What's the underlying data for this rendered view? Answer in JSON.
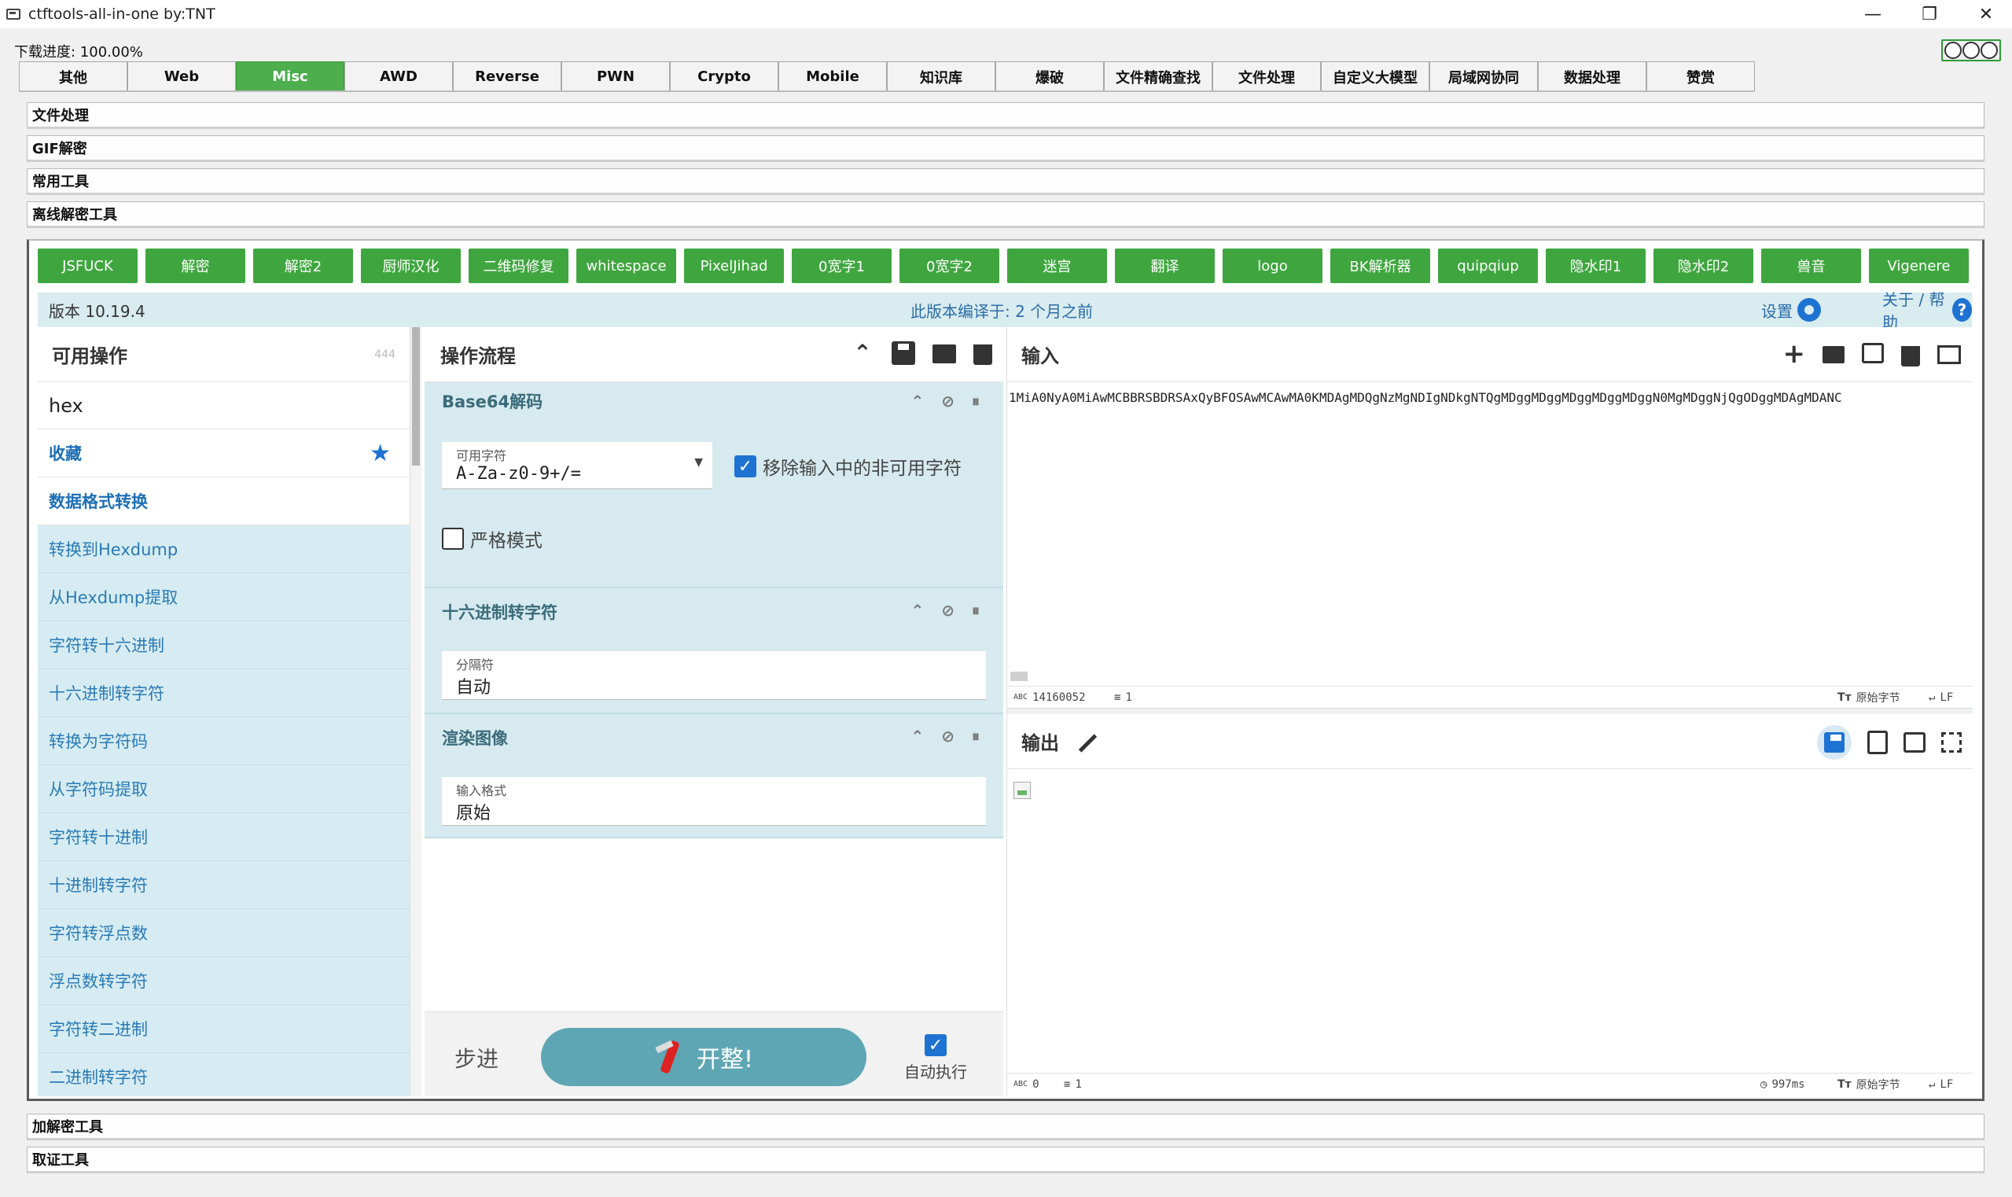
{
  "window": {
    "title": "ctftools-all-in-one   by:TNT",
    "minimize": "—",
    "restore": "❐",
    "close": "✕"
  },
  "progress": {
    "text": "下载进度: 100.00%",
    "value": 100
  },
  "tabs": [
    {
      "label": "其他",
      "active": false
    },
    {
      "label": "Web",
      "active": false
    },
    {
      "label": "Misc",
      "active": true
    },
    {
      "label": "AWD",
      "active": false
    },
    {
      "label": "Reverse",
      "active": false
    },
    {
      "label": "PWN",
      "active": false
    },
    {
      "label": "Crypto",
      "active": false
    },
    {
      "label": "Mobile",
      "active": false
    },
    {
      "label": "知识库",
      "active": false
    },
    {
      "label": "爆破",
      "active": false
    },
    {
      "label": "文件精确查找",
      "active": false
    },
    {
      "label": "文件处理",
      "active": false
    },
    {
      "label": "自定义大模型",
      "active": false
    },
    {
      "label": "局域网协同",
      "active": false
    },
    {
      "label": "数据处理",
      "active": false
    },
    {
      "label": "赞赏",
      "active": false
    }
  ],
  "sections": {
    "s1": "文件处理",
    "s2": "GIF解密",
    "s3": "常用工具",
    "s4": "离线解密工具",
    "s5": "加解密工具",
    "s6": "取证工具"
  },
  "tool_buttons": [
    "JSFUCK",
    "解密",
    "解密2",
    "厨师汉化",
    "二维码修复",
    "whitespace",
    "PixelJihad",
    "0宽字1",
    "0宽字2",
    "迷宫",
    "翻译",
    "logo",
    "BK解析器",
    "quipqiup",
    "隐水印1",
    "隐水印2",
    "兽音",
    "Vigenere"
  ],
  "cyberchef": {
    "version": "版本 10.19.4",
    "built": "此版本编译于:   2 个月之前",
    "settings": "设置",
    "about": "关于 / 帮助"
  },
  "operations": {
    "title": "可用操作",
    "count": "444",
    "search_value": "hex",
    "favourites": "收藏",
    "category": "数据格式转换",
    "items": [
      "转换到Hexdump",
      "从Hexdump提取",
      "字符转十六进制",
      "十六进制转字符",
      "转换为字符码",
      "从字符码提取",
      "字符转十进制",
      "十进制转字符",
      "字符转浮点数",
      "浮点数转字符",
      "字符转二进制",
      "二进制转字符"
    ]
  },
  "recipe": {
    "title": "操作流程",
    "ops": [
      {
        "name": "Base64解码",
        "alphabet_label": "可用字符",
        "alphabet_value": "A-Za-z0-9+/=",
        "remove_nonalpha_label": "移除输入中的非可用字符",
        "remove_nonalpha_checked": true,
        "strict_label": "严格模式",
        "strict_checked": false
      },
      {
        "name": "十六进制转字符",
        "delimiter_label": "分隔符",
        "delimiter_value": "自动"
      },
      {
        "name": "渲染图像",
        "format_label": "输入格式",
        "format_value": "原始"
      }
    ],
    "step": "步进",
    "bake": "开整!",
    "auto_bake": "自动执行",
    "auto_bake_checked": true
  },
  "input": {
    "title": "输入",
    "text": "1MiA0NyA0MiAwMCBBRSBDRSAxQyBFOSAwMCAwMA0KMDAgMDQgNzMgNDIgNDkgNTQgMDggMDggMDggMDggMDggN0MgMDggNjQgODggMDAgMDANC",
    "length": "14160052",
    "lines": "1",
    "encoding": "原始字节",
    "eol": "LF"
  },
  "output": {
    "title": "输出",
    "length": "0",
    "lines": "1",
    "time": "997ms",
    "encoding": "原始字节",
    "eol": "LF"
  }
}
